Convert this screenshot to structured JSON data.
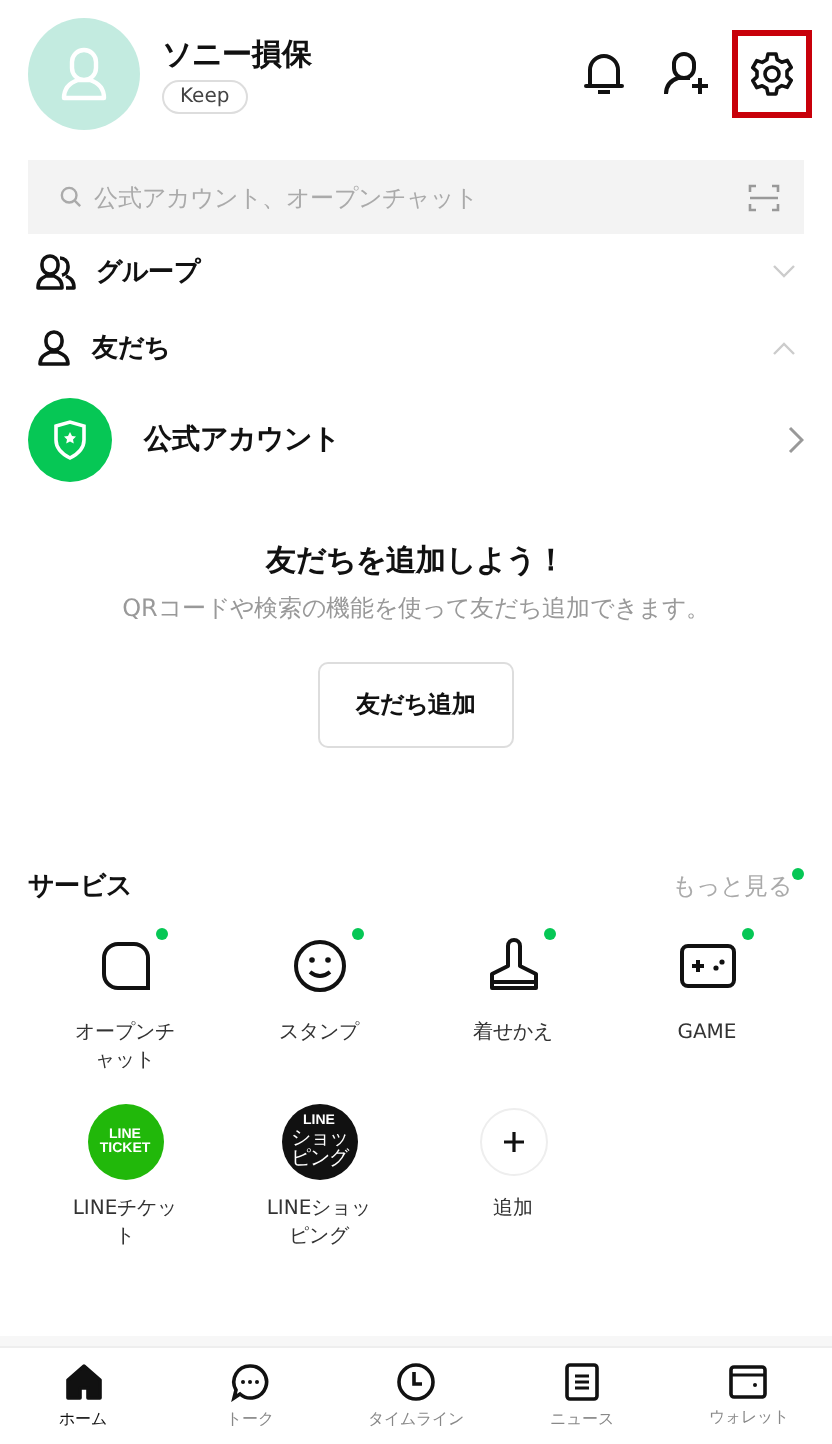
{
  "profile": {
    "name": "ソニー損保",
    "keep_label": "Keep"
  },
  "header_actions": [
    {
      "kind": "bell",
      "highlighted": false
    },
    {
      "kind": "add_friend",
      "highlighted": false
    },
    {
      "kind": "settings",
      "highlighted": true
    }
  ],
  "search": {
    "placeholder": "公式アカウント、オープンチャット"
  },
  "sections": [
    {
      "kind": "group",
      "label": "グループ",
      "expanded": false
    },
    {
      "kind": "friend",
      "label": "友だち",
      "expanded": true
    }
  ],
  "official_account": {
    "label": "公式アカウント"
  },
  "empty_state": {
    "title": "友だちを追加しよう！",
    "message": "QRコードや検索の機能を使って友だち追加できます。",
    "button": "友だち追加"
  },
  "services": {
    "title": "サービス",
    "more": "もっと見る",
    "more_new": true,
    "items": [
      {
        "kind": "open_chat",
        "label": "オープンチャット",
        "new": true
      },
      {
        "kind": "stamp",
        "label": "スタンプ",
        "new": true
      },
      {
        "kind": "theme",
        "label": "着せかえ",
        "new": true
      },
      {
        "kind": "game",
        "label": "GAME",
        "new": true
      },
      {
        "kind": "ticket",
        "label": "LINEチケット",
        "new": false,
        "logo_text": [
          "LINE",
          "TICKET"
        ]
      },
      {
        "kind": "shopping",
        "label": "LINEショッピング",
        "new": false,
        "logo_text": [
          "LINE",
          "ショッピング"
        ]
      },
      {
        "kind": "add",
        "label": "追加",
        "new": false
      }
    ]
  },
  "tab_bar": [
    {
      "kind": "home",
      "label": "ホーム",
      "selected": true
    },
    {
      "kind": "talk",
      "label": "トーク",
      "selected": false
    },
    {
      "kind": "timeline",
      "label": "タイムライン",
      "selected": false
    },
    {
      "kind": "news",
      "label": "ニュース",
      "selected": false
    },
    {
      "kind": "wallet",
      "label": "ウォレット",
      "selected": false
    }
  ]
}
